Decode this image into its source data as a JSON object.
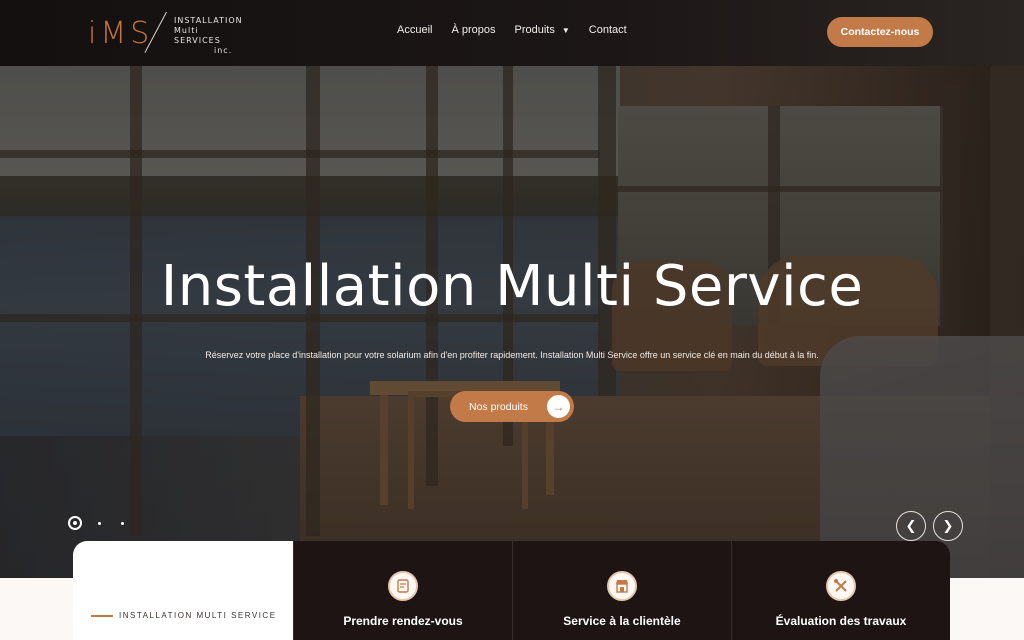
{
  "logo": {
    "mark": "iMS",
    "line1": "INSTALLATION",
    "line2": "Multi",
    "line3": "SERVICES",
    "line4": "inc."
  },
  "nav": {
    "items": [
      {
        "label": "Accueil"
      },
      {
        "label": "À propos"
      },
      {
        "label": "Produits"
      },
      {
        "label": "Contact"
      }
    ]
  },
  "header": {
    "cta_label": "Contactez-nous"
  },
  "hero": {
    "title": "Installation Multi Service",
    "subtitle": "Réservez votre place d'installation pour votre solarium afin d'en profiter rapidement. Installation Multi Service offre un service clé en main du début à la fin.",
    "button_label": "Nos produits"
  },
  "strip": {
    "intro_label": "INSTALLATION MULTI SERVICE",
    "services": [
      {
        "title": "Prendre rendez-vous",
        "icon": "calendar-phone-icon"
      },
      {
        "title": "Service à la clientèle",
        "icon": "storefront-icon"
      },
      {
        "title": "Évaluation des travaux",
        "icon": "tools-icon"
      }
    ]
  },
  "colors": {
    "accent": "#c27a48",
    "dark": "#1d1413"
  }
}
